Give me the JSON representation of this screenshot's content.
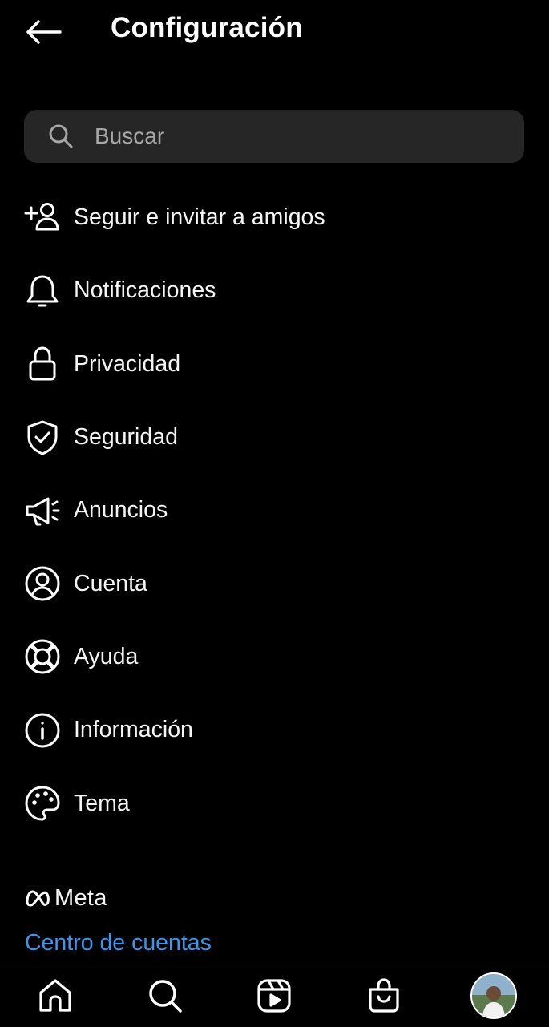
{
  "header": {
    "title": "Configuración",
    "back_icon": "arrow-left-icon"
  },
  "search": {
    "placeholder": "Buscar",
    "value": "",
    "icon": "search-icon"
  },
  "menu": {
    "items": [
      {
        "label": "Seguir e invitar a amigos",
        "icon": "add-person-icon"
      },
      {
        "label": "Notificaciones",
        "icon": "bell-icon"
      },
      {
        "label": "Privacidad",
        "icon": "lock-icon"
      },
      {
        "label": "Seguridad",
        "icon": "shield-check-icon"
      },
      {
        "label": "Anuncios",
        "icon": "megaphone-icon"
      },
      {
        "label": "Cuenta",
        "icon": "user-circle-icon"
      },
      {
        "label": "Ayuda",
        "icon": "lifebuoy-icon"
      },
      {
        "label": "Información",
        "icon": "info-icon"
      },
      {
        "label": "Tema",
        "icon": "palette-icon"
      }
    ]
  },
  "footer": {
    "meta_word": "Meta",
    "accounts_center": "Centro de cuentas"
  },
  "bottom_nav": {
    "items": [
      "home-icon",
      "search-icon",
      "reels-icon",
      "shop-icon",
      "profile-avatar"
    ]
  },
  "colors": {
    "background": "#000000",
    "search_bg": "#262626",
    "link": "#3897f0",
    "text": "#ffffff"
  }
}
